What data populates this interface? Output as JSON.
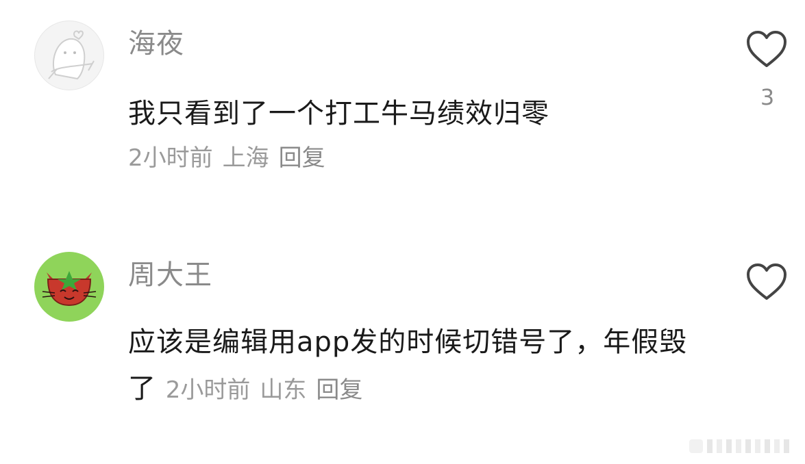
{
  "comments": [
    {
      "username": "海夜",
      "text": "我只看到了一个打工牛马绩效归零",
      "time": "2小时前",
      "location": "上海",
      "reply_label": "回复",
      "like_count": "3",
      "avatar": "cartoon-character-avatar"
    },
    {
      "username": "周大王",
      "text": "应该是编辑用app发的时候切错号了，年假毁了",
      "time": "2小时前",
      "location": "山东",
      "reply_label": "回复",
      "like_count": "",
      "avatar": "strawberry-cat-avatar"
    }
  ],
  "icons": {
    "like": "heart-outline-icon"
  },
  "colors": {
    "background": "#ffffff",
    "username": "#8a8a8a",
    "body_text": "#1a1a1a",
    "meta": "#9a9a9a",
    "avatar2_bg": "#8fd45a"
  }
}
